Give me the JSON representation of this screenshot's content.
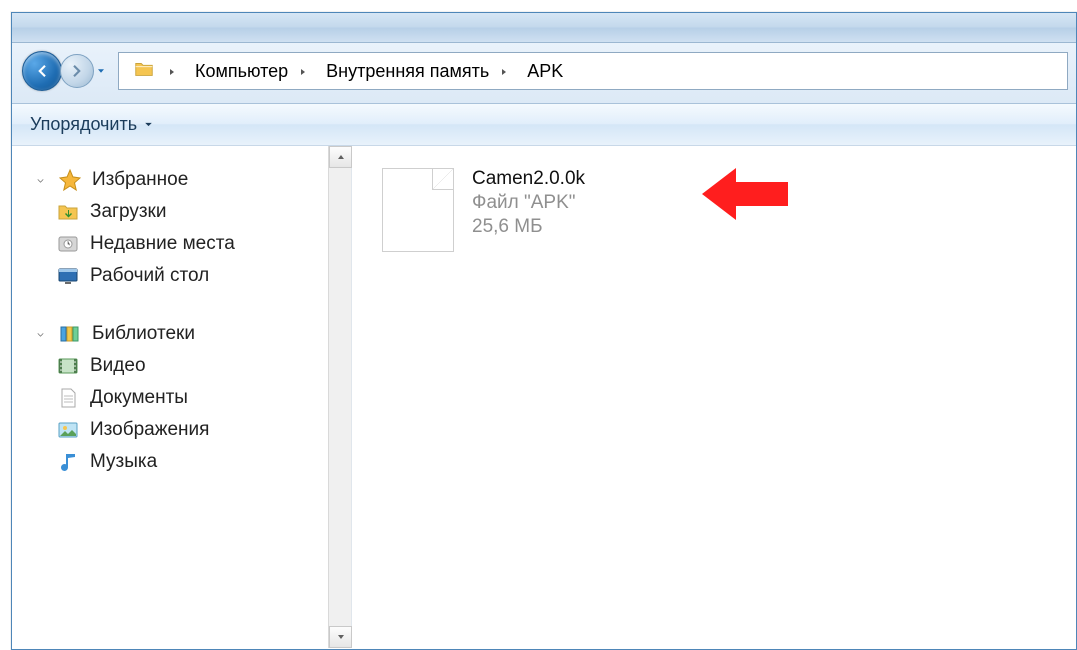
{
  "breadcrumb": {
    "segments": [
      "Компьютер",
      "Внутренняя память",
      "APK"
    ]
  },
  "toolbar": {
    "organize_label": "Упорядочить"
  },
  "nav": {
    "favorites": {
      "label": "Избранное",
      "items": [
        {
          "label": "Загрузки"
        },
        {
          "label": "Недавние места"
        },
        {
          "label": "Рабочий стол"
        }
      ]
    },
    "libraries": {
      "label": "Библиотеки",
      "items": [
        {
          "label": "Видео"
        },
        {
          "label": "Документы"
        },
        {
          "label": "Изображения"
        },
        {
          "label": "Музыка"
        }
      ]
    }
  },
  "file": {
    "name": "Camen2.0.0k",
    "type": "Файл \"APK\"",
    "size": "25,6 МБ"
  }
}
